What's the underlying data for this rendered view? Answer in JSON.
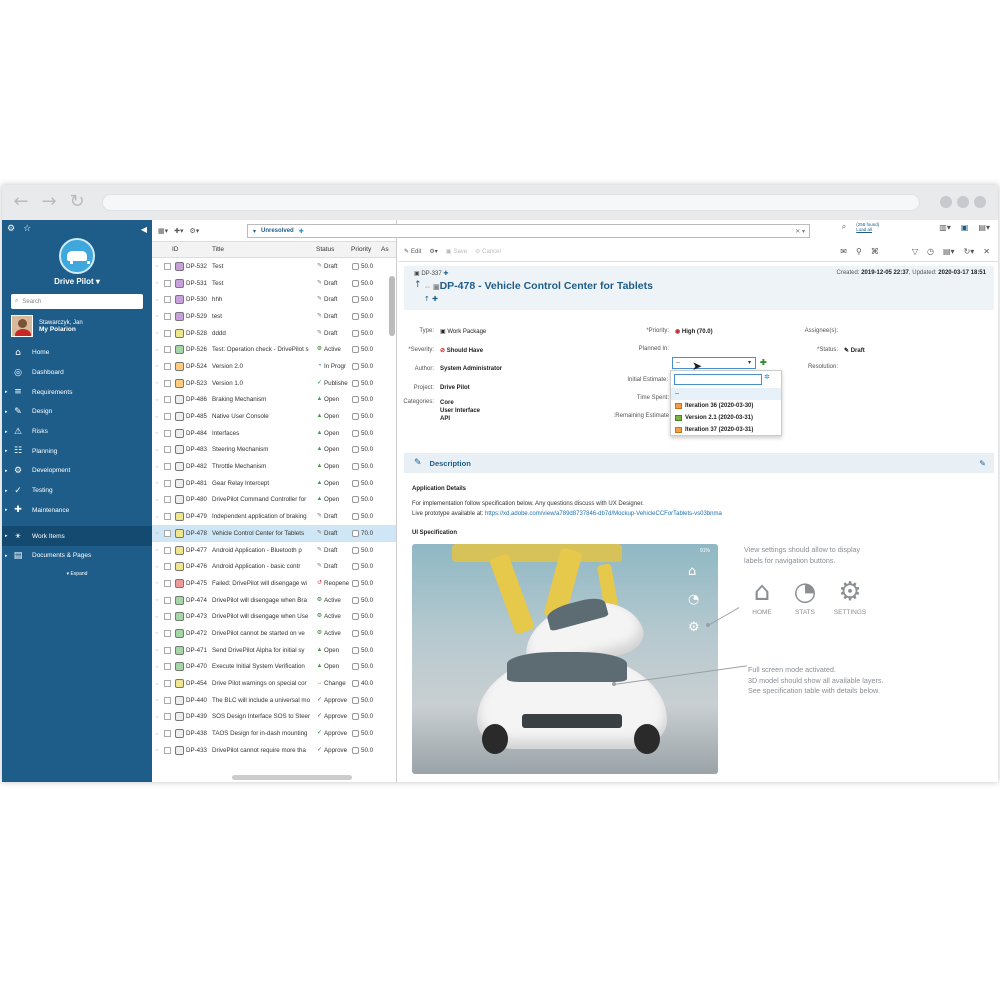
{
  "sidebar": {
    "project_name": "Drive Pilot",
    "search_placeholder": "Search",
    "user_name": "Stawarczyk, Jan",
    "user_link": "My Polarion",
    "items": [
      {
        "label": "Home",
        "icon": "home-icon"
      },
      {
        "label": "Dashboard",
        "icon": "dashboard-icon"
      },
      {
        "label": "Requirements",
        "icon": "requirements-icon"
      },
      {
        "label": "Design",
        "icon": "design-icon"
      },
      {
        "label": "Risks",
        "icon": "risks-icon"
      },
      {
        "label": "Planning",
        "icon": "planning-icon"
      },
      {
        "label": "Development",
        "icon": "development-icon"
      },
      {
        "label": "Testing",
        "icon": "testing-icon"
      },
      {
        "label": "Maintenance",
        "icon": "maintenance-icon"
      },
      {
        "label": "Work Items",
        "icon": "work-items-icon"
      },
      {
        "label": "Documents & Pages",
        "icon": "documents-icon"
      }
    ],
    "expand_label": "Expand"
  },
  "filter": {
    "query": "Unresolved",
    "stat_line1": "(258 found)",
    "stat_line2": "Load all"
  },
  "list": {
    "headers": {
      "id": "ID",
      "title": "Title",
      "status": "Status",
      "priority": "Priority",
      "assignee": "As"
    },
    "rows": [
      {
        "id": "DP-532",
        "title": "Test",
        "status": "Draft",
        "priority": "50.0",
        "color": "#c9a0dc",
        "sicon": "✎"
      },
      {
        "id": "DP-531",
        "title": "Test",
        "status": "Draft",
        "priority": "50.0",
        "color": "#c9a0dc",
        "sicon": "✎"
      },
      {
        "id": "DP-530",
        "title": "hhh",
        "status": "Draft",
        "priority": "50.0",
        "color": "#c9a0dc",
        "sicon": "✎"
      },
      {
        "id": "DP-529",
        "title": "test",
        "status": "Draft",
        "priority": "50.0",
        "color": "#c9a0dc",
        "sicon": "✎"
      },
      {
        "id": "DP-528",
        "title": "dddd",
        "status": "Draft",
        "priority": "50.0",
        "color": "#f0e68c",
        "sicon": "✎"
      },
      {
        "id": "DP-526",
        "title": "Test: Operation check - DrivePilot s",
        "status": "Active",
        "priority": "50.0",
        "color": "#a5d6a7",
        "sicon": "⚙"
      },
      {
        "id": "DP-524",
        "title": "Version 2.0",
        "status": "In Progr",
        "priority": "50.0",
        "color": "#ffcc80",
        "sicon": "◔"
      },
      {
        "id": "DP-523",
        "title": "Version 1.0",
        "status": "Publishe",
        "priority": "50.0",
        "color": "#ffcc80",
        "sicon": "✓"
      },
      {
        "id": "DP-486",
        "title": "Braking Mechanism",
        "status": "Open",
        "priority": "50.0",
        "color": "#eeeeee",
        "sicon": "▲"
      },
      {
        "id": "DP-485",
        "title": "Native User Console",
        "status": "Open",
        "priority": "50.0",
        "color": "#eeeeee",
        "sicon": "▲"
      },
      {
        "id": "DP-484",
        "title": "Interfaces",
        "status": "Open",
        "priority": "50.0",
        "color": "#eeeeee",
        "sicon": "▲"
      },
      {
        "id": "DP-483",
        "title": "Steering Mechanism",
        "status": "Open",
        "priority": "50.0",
        "color": "#eeeeee",
        "sicon": "▲"
      },
      {
        "id": "DP-482",
        "title": "Throttle Mechanism",
        "status": "Open",
        "priority": "50.0",
        "color": "#eeeeee",
        "sicon": "▲"
      },
      {
        "id": "DP-481",
        "title": "Gear Relay Intercept",
        "status": "Open",
        "priority": "50.0",
        "color": "#eeeeee",
        "sicon": "▲"
      },
      {
        "id": "DP-480",
        "title": "DrivePilot Command Controller for",
        "status": "Open",
        "priority": "50.0",
        "color": "#eeeeee",
        "sicon": "▲"
      },
      {
        "id": "DP-479",
        "title": "Independent application of braking",
        "status": "Draft",
        "priority": "50.0",
        "color": "#f0e68c",
        "sicon": "✎"
      },
      {
        "id": "DP-478",
        "title": "Vehicle Control Center for Tablets",
        "status": "Draft",
        "priority": "70.0",
        "color": "#f0e68c",
        "sicon": "✎",
        "selected": true
      },
      {
        "id": "DP-477",
        "title": "Android Application - Bluetooth p",
        "status": "Draft",
        "priority": "50.0",
        "color": "#f0e68c",
        "sicon": "✎"
      },
      {
        "id": "DP-476",
        "title": "Android Application - basic contr",
        "status": "Draft",
        "priority": "50.0",
        "color": "#f0e68c",
        "sicon": "✎"
      },
      {
        "id": "DP-475",
        "title": "Failed: DrivePilot will disengage wi",
        "status": "Reopene",
        "priority": "50.0",
        "color": "#ef9a9a",
        "sicon": "↺"
      },
      {
        "id": "DP-474",
        "title": "DrivePilot will disengage when Bra",
        "status": "Active",
        "priority": "50.0",
        "color": "#a5d6a7",
        "sicon": "⚙"
      },
      {
        "id": "DP-473",
        "title": "DrivePilot will disengage when Use",
        "status": "Active",
        "priority": "50.0",
        "color": "#a5d6a7",
        "sicon": "⚙"
      },
      {
        "id": "DP-472",
        "title": "DrivePilot cannot be started on ve",
        "status": "Active",
        "priority": "50.0",
        "color": "#a5d6a7",
        "sicon": "⚙"
      },
      {
        "id": "DP-471",
        "title": "Send DrivePilot Alpha for initial sy",
        "status": "Open",
        "priority": "50.0",
        "color": "#a5d6a7",
        "sicon": "▲"
      },
      {
        "id": "DP-470",
        "title": "Execute Initial System Verification",
        "status": "Open",
        "priority": "50.0",
        "color": "#a5d6a7",
        "sicon": "▲"
      },
      {
        "id": "DP-454",
        "title": "Drive Pilot warnings on special cor",
        "status": "Change",
        "priority": "40.0",
        "color": "#f0e68c",
        "sicon": "↔"
      },
      {
        "id": "DP-440",
        "title": "The BLC will include a universal mo",
        "status": "Approve",
        "priority": "50.0",
        "color": "#eeeeee",
        "sicon": "✓"
      },
      {
        "id": "DP-439",
        "title": "SOS Design Interface SOS to Steer",
        "status": "Approve",
        "priority": "50.0",
        "color": "#eeeeee",
        "sicon": "✓"
      },
      {
        "id": "DP-438",
        "title": "TAOS Design for in-dash mounting",
        "status": "Approve",
        "priority": "50.0",
        "color": "#eeeeee",
        "sicon": "✓"
      },
      {
        "id": "DP-433",
        "title": "DrivePilot cannot require more tha",
        "status": "Approve",
        "priority": "50.0",
        "color": "#eeeeee",
        "sicon": "✓"
      }
    ]
  },
  "detail": {
    "toolbar": {
      "edit": "Edit",
      "save": "Save",
      "cancel": "Cancel"
    },
    "parent_id": "DP-337",
    "title": "DP-478 - Vehicle Control Center for Tablets",
    "created_label": "Created:",
    "created": "2019-12-05 22:37",
    "updated_label": "Updated:",
    "updated": "2020-03-17 18:51",
    "fields": {
      "type_label": "Type:",
      "type_value": "Work Package",
      "severity_label": "*Severity:",
      "severity_value": "Should Have",
      "author_label": "Author:",
      "author_value": "System Administrator",
      "project_label": "Project:",
      "project_value": "Drive Pilot",
      "categories_label": "Categories:",
      "categories": [
        "Core",
        "User Interface",
        "API"
      ],
      "priority_label": "*Priority:",
      "priority_value": "High (70.0)",
      "planned_label": "Planned In:",
      "planned_value": "--",
      "initial_label": "Initial Estimate:",
      "spent_label": "Time Spent:",
      "remaining_label": "Remaining Estimate:",
      "assignee_label": "Assignee(s):",
      "status_label": "*Status:",
      "status_value": "Draft",
      "resolution_label": "Resolution:"
    },
    "dropdown_options": [
      "--",
      "Iteration 36 (2020-03-30)",
      "Version 2.1 (2020-03-31)",
      "Iteration 37 (2020-03-31)"
    ],
    "description_header": "Description",
    "app_details": "Application Details",
    "desc_line1": "For implementation follow specification below. Any questions discuss with UX Designer.",
    "desc_line2": "Live prototype available at: ",
    "desc_link": "https://xd.adobe.com/view/a789d8737846-db7d/Mockup-VehicleCCForTablets-vs03bnma",
    "ui_spec": "UI Specification",
    "phone_status": "91%",
    "callout1": [
      "View settings should allow to display",
      "labels for navigation buttons."
    ],
    "callout_icons": [
      {
        "label": "HOME",
        "icon": "home-icon"
      },
      {
        "label": "STATS",
        "icon": "stats-icon"
      },
      {
        "label": "SETTINGS",
        "icon": "settings-icon"
      }
    ],
    "callout2": [
      "Full screen mode activated.",
      "3D model should show all available layers.",
      "See specification table with details below."
    ]
  }
}
